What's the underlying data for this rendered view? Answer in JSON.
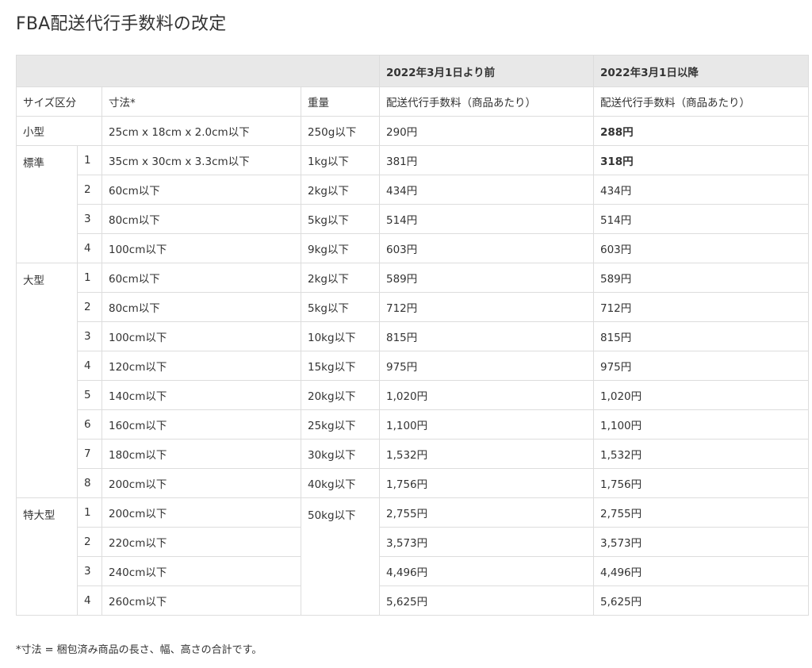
{
  "title": "FBA配送代行手数料の改定",
  "header": {
    "before": "2022年3月1日より前",
    "after": "2022年3月1日以降"
  },
  "subheader": {
    "size_class": "サイズ区分",
    "dimensions": "寸法*",
    "weight": "重量",
    "fee_before": "配送代行手数料（商品あたり）",
    "fee_after": "配送代行手数料（商品あたり）"
  },
  "small": {
    "label": "小型",
    "dimensions": "25cm x 18cm x 2.0cm以下",
    "weight": "250g以下",
    "before": "290円",
    "after": "288円"
  },
  "standard": {
    "label": "標準",
    "rows": [
      {
        "num": "1",
        "dimensions": "35cm x 30cm x 3.3cm以下",
        "weight": "1kg以下",
        "before": "381円",
        "after": "318円"
      },
      {
        "num": "2",
        "dimensions": "60cm以下",
        "weight": "2kg以下",
        "before": "434円",
        "after": "434円"
      },
      {
        "num": "3",
        "dimensions": "80cm以下",
        "weight": "5kg以下",
        "before": "514円",
        "after": "514円"
      },
      {
        "num": "4",
        "dimensions": "100cm以下",
        "weight": "9kg以下",
        "before": "603円",
        "after": "603円"
      }
    ]
  },
  "large": {
    "label": "大型",
    "rows": [
      {
        "num": "1",
        "dimensions": "60cm以下",
        "weight": "2kg以下",
        "before": "589円",
        "after": "589円"
      },
      {
        "num": "2",
        "dimensions": "80cm以下",
        "weight": "5kg以下",
        "before": "712円",
        "after": "712円"
      },
      {
        "num": "3",
        "dimensions": "100cm以下",
        "weight": "10kg以下",
        "before": "815円",
        "after": "815円"
      },
      {
        "num": "4",
        "dimensions": "120cm以下",
        "weight": "15kg以下",
        "before": "975円",
        "after": "975円"
      },
      {
        "num": "5",
        "dimensions": "140cm以下",
        "weight": "20kg以下",
        "before": "1,020円",
        "after": "1,020円"
      },
      {
        "num": "6",
        "dimensions": "160cm以下",
        "weight": "25kg以下",
        "before": "1,100円",
        "after": "1,100円"
      },
      {
        "num": "7",
        "dimensions": "180cm以下",
        "weight": "30kg以下",
        "before": "1,532円",
        "after": "1,532円"
      },
      {
        "num": "8",
        "dimensions": "200cm以下",
        "weight": "40kg以下",
        "before": "1,756円",
        "after": "1,756円"
      }
    ]
  },
  "oversize": {
    "label": "特大型",
    "weight": "50kg以下",
    "rows": [
      {
        "num": "1",
        "dimensions": "200cm以下",
        "before": "2,755円",
        "after": "2,755円"
      },
      {
        "num": "2",
        "dimensions": "220cm以下",
        "before": "3,573円",
        "after": "3,573円"
      },
      {
        "num": "3",
        "dimensions": "240cm以下",
        "before": "4,496円",
        "after": "4,496円"
      },
      {
        "num": "4",
        "dimensions": "260cm以下",
        "before": "5,625円",
        "after": "5,625円"
      }
    ]
  },
  "footnote": "*寸法 = 梱包済み商品の長さ、幅、高さの合計です。"
}
